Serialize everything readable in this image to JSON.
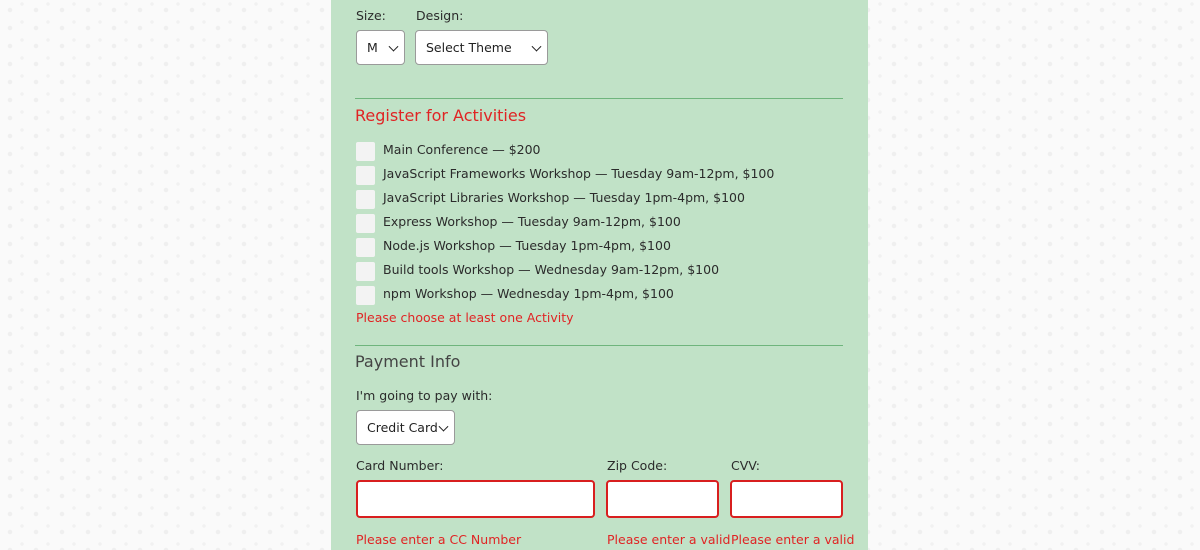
{
  "size": {
    "label": "Size:",
    "selected": "M"
  },
  "design": {
    "label": "Design:",
    "selected": "Select Theme"
  },
  "activities": {
    "title": "Register for Activities",
    "items": [
      "Main Conference — $200",
      "JavaScript Frameworks Workshop — Tuesday 9am-12pm, $100",
      "JavaScript Libraries Workshop — Tuesday 1pm-4pm, $100",
      "Express Workshop — Tuesday 9am-12pm, $100",
      "Node.js Workshop — Tuesday 1pm-4pm, $100",
      "Build tools Workshop — Wednesday 9am-12pm, $100",
      "npm Workshop — Wednesday 1pm-4pm, $100"
    ],
    "error": "Please choose at least one Activity"
  },
  "payment": {
    "title": "Payment Info",
    "pay_label": "I'm going to pay with:",
    "pay_selected": "Credit Card",
    "card_number_label": "Card Number:",
    "zip_label": "Zip Code:",
    "cvv_label": "CVV:",
    "card_error": "Please enter a CC Number",
    "zip_error": "Please enter a valid",
    "cvv_error": "Please enter a valid"
  },
  "colors": {
    "panel_bg": "#c1e2c7",
    "error": "#e02424",
    "rule": "#6fb57d"
  }
}
